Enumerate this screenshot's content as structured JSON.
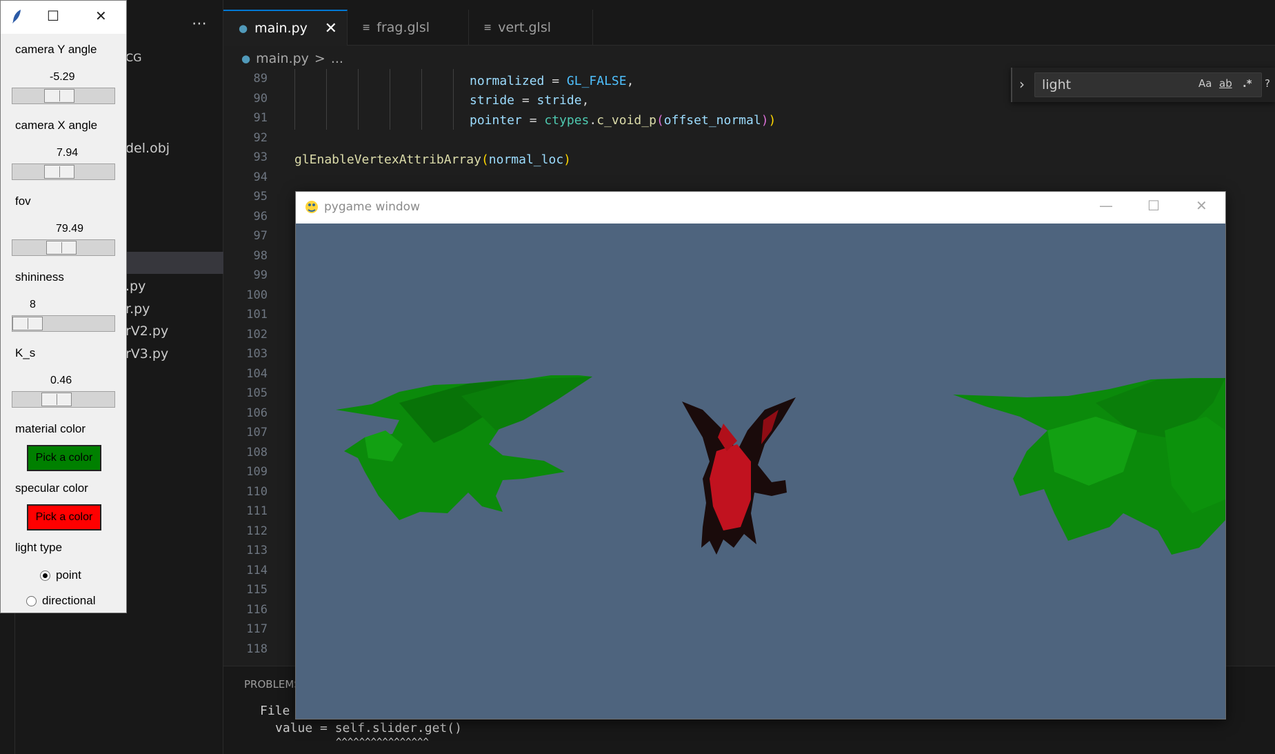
{
  "explorer": {
    "more_label": "⋯",
    "folder_label": "CG",
    "files": [
      "del.obj",
      ".py",
      "r.py",
      "rV2.py",
      "rV3.py"
    ]
  },
  "tabs": [
    {
      "label": "main.py",
      "icon": "python-file-icon",
      "active": true
    },
    {
      "label": "frag.glsl",
      "icon": "text-file-icon",
      "active": false
    },
    {
      "label": "vert.glsl",
      "icon": "text-file-icon",
      "active": false
    }
  ],
  "breadcrumb": {
    "file": "main.py",
    "sep": ">",
    "rest": "..."
  },
  "editor": {
    "line_numbers": [
      "89",
      "90",
      "91",
      "92",
      "93",
      "94",
      "95",
      "96",
      "97",
      "98",
      "99",
      "100",
      "101",
      "102",
      "103",
      "104",
      "105",
      "106",
      "107",
      "108",
      "109",
      "110",
      "111",
      "112",
      "113",
      "114",
      "115",
      "116",
      "117",
      "118"
    ]
  },
  "find_widget": {
    "query": "light",
    "case_label": "Aa",
    "word_label": "ab",
    "regex_label": ".*",
    "help_label": "?"
  },
  "panel": {
    "title": "PROBLEMS",
    "line1": "File",
    "line2": "value = self.slider.get()",
    "line3": "^^^^^^^^^^^^^^^^"
  },
  "pygame": {
    "title": "pygame window",
    "colors": {
      "background": "#4e647e"
    }
  },
  "tk": {
    "camera_y": {
      "label": "camera Y angle",
      "value": "-5.29",
      "level": 0.45
    },
    "camera_x": {
      "label": "camera X angle",
      "value": "7.94",
      "level": 0.45
    },
    "fov": {
      "label": "fov",
      "value": "79.49",
      "level": 0.48
    },
    "shininess": {
      "label": "shininess",
      "value": "8",
      "level": 0.0
    },
    "ks": {
      "label": "K_s",
      "value": "0.46",
      "level": 0.41
    },
    "material_color": {
      "label": "material color",
      "button": "Pick a color",
      "color": "#008000"
    },
    "specular_color": {
      "label": "specular color",
      "button": "Pick a color",
      "color": "#ff0000"
    },
    "light_type": {
      "label": "light type",
      "options": [
        "point",
        "directional"
      ],
      "selected": "point"
    }
  }
}
